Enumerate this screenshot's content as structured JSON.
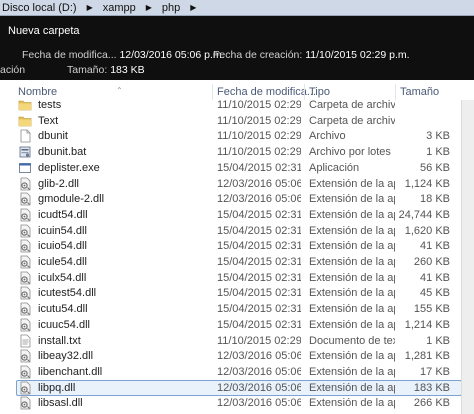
{
  "breadcrumb": [
    "Disco local (D:)",
    "xampp",
    "php"
  ],
  "details": {
    "folder_name": "Nueva carpeta",
    "modified_label": "Fecha de modifica...",
    "modified_value": "12/03/2016 05:06 p.m.",
    "created_label": "Fecha de creación:",
    "created_value": "11/10/2015 02:29 p.m.",
    "cut_label": "ación",
    "size_label": "Tamaño:",
    "size_value": "183 KB"
  },
  "columns": {
    "name": "Nombre",
    "date": "Fecha de modifica...",
    "type": "Tipo",
    "size": "Tamaño"
  },
  "files": [
    {
      "name": "tests",
      "date": "11/10/2015 02:29 ...",
      "type": "Carpeta de archivos",
      "size": "",
      "icon": "folder-icon"
    },
    {
      "name": "Text",
      "date": "11/10/2015 02:29 ...",
      "type": "Carpeta de archivos",
      "size": "",
      "icon": "folder-icon"
    },
    {
      "name": "dbunit",
      "date": "11/10/2015 02:29 ...",
      "type": "Archivo",
      "size": "3 KB",
      "icon": "file-icon"
    },
    {
      "name": "dbunit.bat",
      "date": "11/10/2015 02:29 ...",
      "type": "Archivo por lotes ...",
      "size": "1 KB",
      "icon": "batch-file-icon"
    },
    {
      "name": "deplister.exe",
      "date": "15/04/2015 02:31 ...",
      "type": "Aplicación",
      "size": "56 KB",
      "icon": "exe-icon"
    },
    {
      "name": "glib-2.dll",
      "date": "12/03/2016 05:06 ...",
      "type": "Extensión de la apl...",
      "size": "1,124 KB",
      "icon": "dll-icon"
    },
    {
      "name": "gmodule-2.dll",
      "date": "12/03/2016 05:06 ...",
      "type": "Extensión de la apl...",
      "size": "18 KB",
      "icon": "dll-icon"
    },
    {
      "name": "icudt54.dll",
      "date": "15/04/2015 02:31 ...",
      "type": "Extensión de la apl...",
      "size": "24,744 KB",
      "icon": "dll-icon"
    },
    {
      "name": "icuin54.dll",
      "date": "15/04/2015 02:31 ...",
      "type": "Extensión de la apl...",
      "size": "1,620 KB",
      "icon": "dll-icon"
    },
    {
      "name": "icuio54.dll",
      "date": "15/04/2015 02:31 ...",
      "type": "Extensión de la apl...",
      "size": "41 KB",
      "icon": "dll-icon"
    },
    {
      "name": "icule54.dll",
      "date": "15/04/2015 02:31 ...",
      "type": "Extensión de la apl...",
      "size": "260 KB",
      "icon": "dll-icon"
    },
    {
      "name": "iculx54.dll",
      "date": "15/04/2015 02:31 ...",
      "type": "Extensión de la apl...",
      "size": "41 KB",
      "icon": "dll-icon"
    },
    {
      "name": "icutest54.dll",
      "date": "15/04/2015 02:31 ...",
      "type": "Extensión de la apl...",
      "size": "45 KB",
      "icon": "dll-icon"
    },
    {
      "name": "icutu54.dll",
      "date": "15/04/2015 02:31 ...",
      "type": "Extensión de la apl...",
      "size": "155 KB",
      "icon": "dll-icon"
    },
    {
      "name": "icuuc54.dll",
      "date": "15/04/2015 02:31 ...",
      "type": "Extensión de la apl...",
      "size": "1,214 KB",
      "icon": "dll-icon"
    },
    {
      "name": "install.txt",
      "date": "11/10/2015 02:29 ...",
      "type": "Documento de tex...",
      "size": "1 KB",
      "icon": "text-file-icon"
    },
    {
      "name": "libeay32.dll",
      "date": "12/03/2016 05:06 ...",
      "type": "Extensión de la apl...",
      "size": "1,281 KB",
      "icon": "dll-icon"
    },
    {
      "name": "libenchant.dll",
      "date": "12/03/2016 05:06 ...",
      "type": "Extensión de la apl...",
      "size": "17 KB",
      "icon": "dll-icon"
    },
    {
      "name": "libpq.dll",
      "date": "12/03/2016 05:06 ...",
      "type": "Extensión de la apl...",
      "size": "183 KB",
      "icon": "dll-icon",
      "selected": true
    },
    {
      "name": "libsasl.dll",
      "date": "12/03/2016 05:06 ...",
      "type": "Extensión de la apl...",
      "size": "266 KB",
      "icon": "dll-icon"
    }
  ],
  "colors": {
    "details_bg": "#0f0f0f",
    "selection_bg": "#e9f1fb",
    "selection_border": "#7da2ce",
    "header_text": "#4a5a78"
  }
}
